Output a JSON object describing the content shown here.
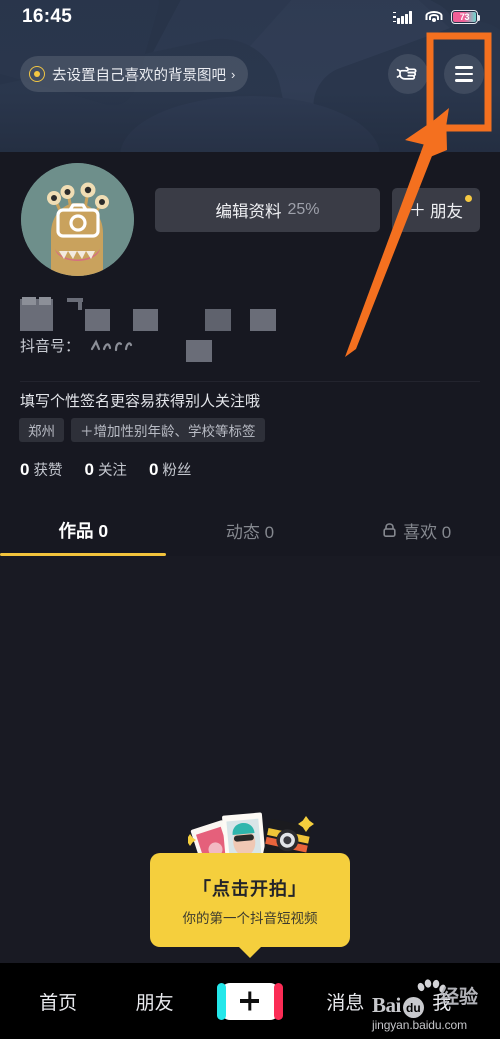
{
  "status_bar": {
    "time": "16:45",
    "battery_percent": "73",
    "icons": [
      "signal-icon",
      "wifi-icon",
      "battery-icon"
    ]
  },
  "cover": {
    "banner_text": "去设置自己喜欢的背景图吧",
    "banner_chevron": "›",
    "hand_icon": "pointing-hand-icon",
    "menu_icon": "hamburger-menu-icon"
  },
  "profile": {
    "avatar_icon": "camera-icon",
    "edit_button": {
      "label": "编辑资料",
      "percent": "25%"
    },
    "friend_button": {
      "plus": "＋",
      "label": "朋友",
      "badge": true
    },
    "id_label": "抖音号：",
    "bio_placeholder": "填写个性签名更容易获得别人关注哦",
    "tags": [
      "郑州",
      "＋增加性别年龄、学校等标签"
    ],
    "stats": [
      {
        "num": "0",
        "label": "获赞"
      },
      {
        "num": "0",
        "label": "关注"
      },
      {
        "num": "0",
        "label": "粉丝"
      }
    ]
  },
  "tabs": [
    {
      "label": "作品 0",
      "active": true,
      "icon": ""
    },
    {
      "label": "动态 0",
      "active": false,
      "icon": ""
    },
    {
      "label": "喜欢 0",
      "active": false,
      "icon": "lock-icon"
    }
  ],
  "shoot_card": {
    "title": "「点击开拍」",
    "subtitle": "你的第一个抖音短视频",
    "illustration": "photos-and-camera-icon"
  },
  "bottom_nav": [
    {
      "label": "首页",
      "type": "text"
    },
    {
      "label": "朋友",
      "type": "text"
    },
    {
      "label": "",
      "type": "plus-button"
    },
    {
      "label": "消息",
      "type": "text"
    },
    {
      "label": "我",
      "type": "text"
    }
  ],
  "watermark": {
    "brand": "Bai",
    "du": "du",
    "cn": "经验",
    "url": "jingyan.baidu.com"
  },
  "annotation": {
    "color": "#f4701f",
    "shapes": [
      "highlight-rectangle",
      "pointer-arrow"
    ]
  }
}
